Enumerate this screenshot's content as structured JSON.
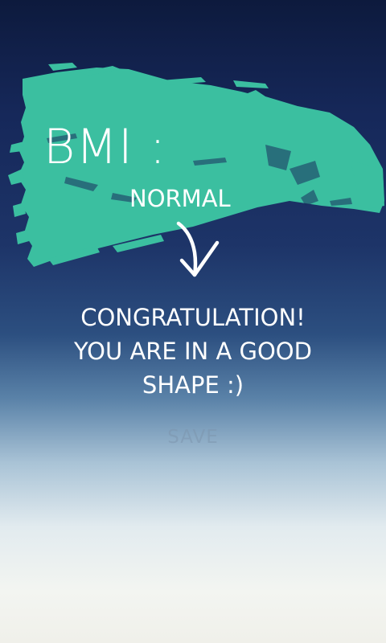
{
  "result": {
    "title": "BMI :",
    "status": "NORMAL"
  },
  "message": {
    "line1": "CONGRATULATION!",
    "line2": "YOU ARE IN A GOOD",
    "line3": "SHAPE :)"
  },
  "actions": {
    "save_label": "SAVE"
  },
  "colors": {
    "accent": "#3bbfa0",
    "background_top": "#0d1a3d",
    "background_bottom": "#f0f0ea",
    "text": "#ffffff"
  },
  "icons": {
    "arrow": "hand-drawn-down-arrow-icon",
    "brush": "brush-stroke-banner"
  }
}
